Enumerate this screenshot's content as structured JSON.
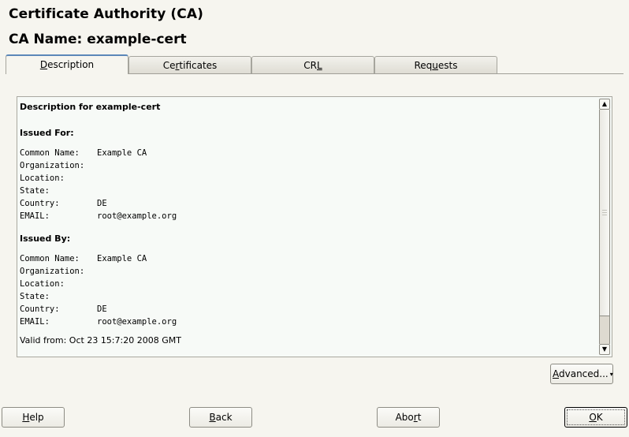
{
  "header": {
    "title": "Certificate Authority (CA)",
    "ca_name_label": "CA Name: example-cert"
  },
  "tabs": [
    {
      "label": "Description",
      "mnemonic_index": 0,
      "active": true
    },
    {
      "label": "Certificates",
      "mnemonic_index": 2,
      "active": false
    },
    {
      "label": "CRL",
      "mnemonic_index": 2,
      "active": false
    },
    {
      "label": "Requests",
      "mnemonic_index": 3,
      "active": false
    }
  ],
  "description": {
    "heading": "Description for example-cert",
    "issued_for": {
      "heading": "Issued For:",
      "fields": [
        {
          "label": "Common Name:",
          "value": "Example CA"
        },
        {
          "label": "Organization:",
          "value": ""
        },
        {
          "label": "Location:",
          "value": ""
        },
        {
          "label": "State:",
          "value": ""
        },
        {
          "label": "Country:",
          "value": "DE"
        },
        {
          "label": "EMAIL:",
          "value": "root@example.org"
        }
      ]
    },
    "issued_by": {
      "heading": "Issued By:",
      "fields": [
        {
          "label": "Common Name:",
          "value": "Example CA"
        },
        {
          "label": "Organization:",
          "value": ""
        },
        {
          "label": "Location:",
          "value": ""
        },
        {
          "label": "State:",
          "value": ""
        },
        {
          "label": "Country:",
          "value": "DE"
        },
        {
          "label": "EMAIL:",
          "value": "root@example.org"
        }
      ]
    },
    "valid_from": "Valid from: Oct 23 15:7:20 2008 GMT"
  },
  "scrollbar": {
    "up_icon": "▲",
    "down_icon": "▼",
    "position_percent": 0
  },
  "buttons": {
    "advanced": {
      "label": "Advanced...",
      "mnemonic_index": 0,
      "icon": "▾"
    },
    "help": {
      "label": "Help",
      "mnemonic_index": 0
    },
    "back": {
      "label": "Back",
      "mnemonic_index": 0
    },
    "abort": {
      "label": "Abort",
      "mnemonic_index": 3
    },
    "ok": {
      "label": "OK",
      "mnemonic_index": 0
    }
  }
}
